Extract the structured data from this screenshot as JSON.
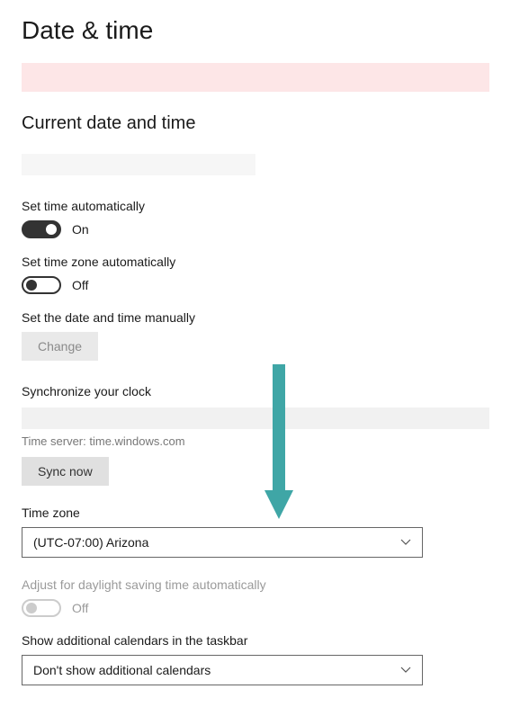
{
  "page_title": "Date & time",
  "section_heading": "Current date and time",
  "set_time_auto": {
    "label": "Set time automatically",
    "state": "On",
    "on": true
  },
  "set_tz_auto": {
    "label": "Set time zone automatically",
    "state": "Off",
    "on": false
  },
  "manual": {
    "label": "Set the date and time manually",
    "button": "Change"
  },
  "sync": {
    "heading": "Synchronize your clock",
    "server_label": "Time server: time.windows.com",
    "button": "Sync now"
  },
  "timezone": {
    "label": "Time zone",
    "selected": "(UTC-07:00) Arizona"
  },
  "dst": {
    "label": "Adjust for daylight saving time automatically",
    "state": "Off",
    "disabled": true
  },
  "calendars": {
    "label": "Show additional calendars in the taskbar",
    "selected": "Don't show additional calendars"
  }
}
